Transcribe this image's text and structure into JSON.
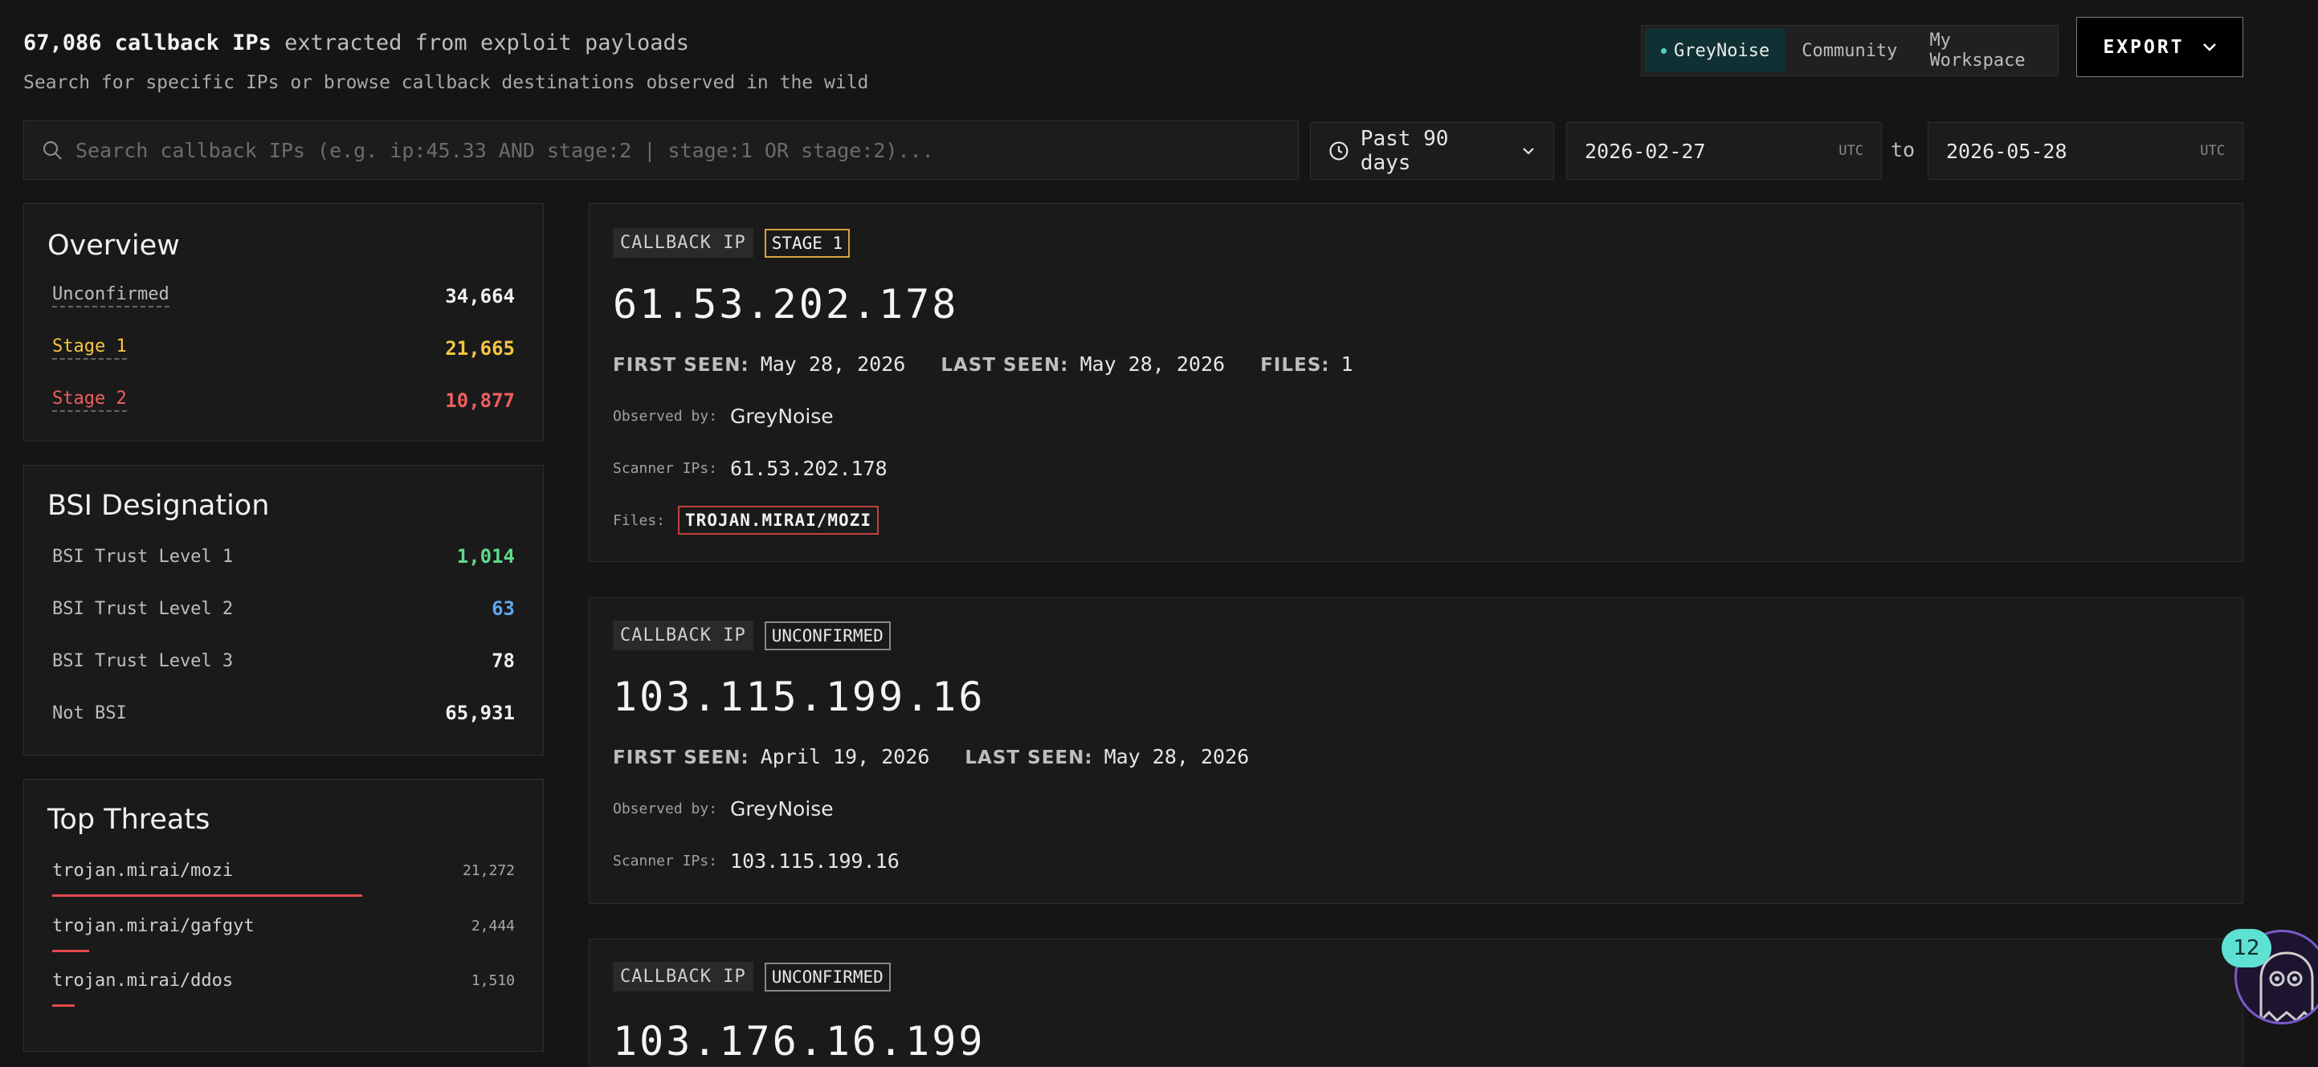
{
  "header": {
    "count": "67,086 callback IPs",
    "count_suffix": " extracted from exploit payloads",
    "subtitle": "Search for specific IPs or browse callback destinations observed in the wild"
  },
  "workspace": {
    "options": [
      "GreyNoise",
      "Community",
      "My Workspace"
    ],
    "active": "GreyNoise"
  },
  "export": {
    "label": "EXPORT"
  },
  "search": {
    "placeholder": "Search callback IPs (e.g. ip:45.33 AND stage:2 | stage:1 OR stage:2)..."
  },
  "filters": {
    "range_label": "Past 90 days",
    "from_date": "2026-02-27",
    "to_date": "2026-05-28",
    "tz": "UTC",
    "to_word": "to"
  },
  "overview": {
    "title": "Overview",
    "rows": [
      {
        "label": "Unconfirmed",
        "value": "34,664"
      },
      {
        "label": "Stage 1",
        "value": "21,665"
      },
      {
        "label": "Stage 2",
        "value": "10,877"
      }
    ]
  },
  "bsi": {
    "title": "BSI Designation",
    "rows": [
      {
        "label": "BSI Trust Level 1",
        "value": "1,014"
      },
      {
        "label": "BSI Trust Level 2",
        "value": "63"
      },
      {
        "label": "BSI Trust Level 3",
        "value": "78"
      },
      {
        "label": "Not BSI",
        "value": "65,931"
      }
    ]
  },
  "threats": {
    "title": "Top Threats",
    "rows": [
      {
        "label": "trojan.mirai/mozi",
        "value": "21,272"
      },
      {
        "label": "trojan.mirai/gafgyt",
        "value": "2,444"
      },
      {
        "label": "trojan.mirai/ddos",
        "value": "1,510"
      }
    ]
  },
  "labels": {
    "callback_ip": "CALLBACK IP",
    "first_seen": "FIRST SEEN:",
    "last_seen": "LAST SEEN:",
    "files_count": "FILES:",
    "observed_by": "Observed by:",
    "scanner_ips": "Scanner IPs:",
    "files": "Files:"
  },
  "cards": [
    {
      "stage": "STAGE 1",
      "ip": "61.53.202.178",
      "first_seen": "May 28, 2026",
      "last_seen": "May 28, 2026",
      "files_count": "1",
      "observed_by": "GreyNoise",
      "scanner_ips": "61.53.202.178",
      "file": "TROJAN.MIRAI/MOZI"
    },
    {
      "stage": "UNCONFIRMED",
      "ip": "103.115.199.16",
      "first_seen": "April 19, 2026",
      "last_seen": "May 28, 2026",
      "observed_by": "GreyNoise",
      "scanner_ips": "103.115.199.16"
    },
    {
      "stage": "UNCONFIRMED",
      "ip": "103.176.16.199"
    }
  ],
  "notifications": {
    "count": "12"
  },
  "colors": {
    "stage1": "#f5c542",
    "stage2": "#ef5f5f",
    "bsi1": "#5fd98a",
    "bsi2": "#5fa8ef",
    "accent": "#4fd1c5"
  }
}
